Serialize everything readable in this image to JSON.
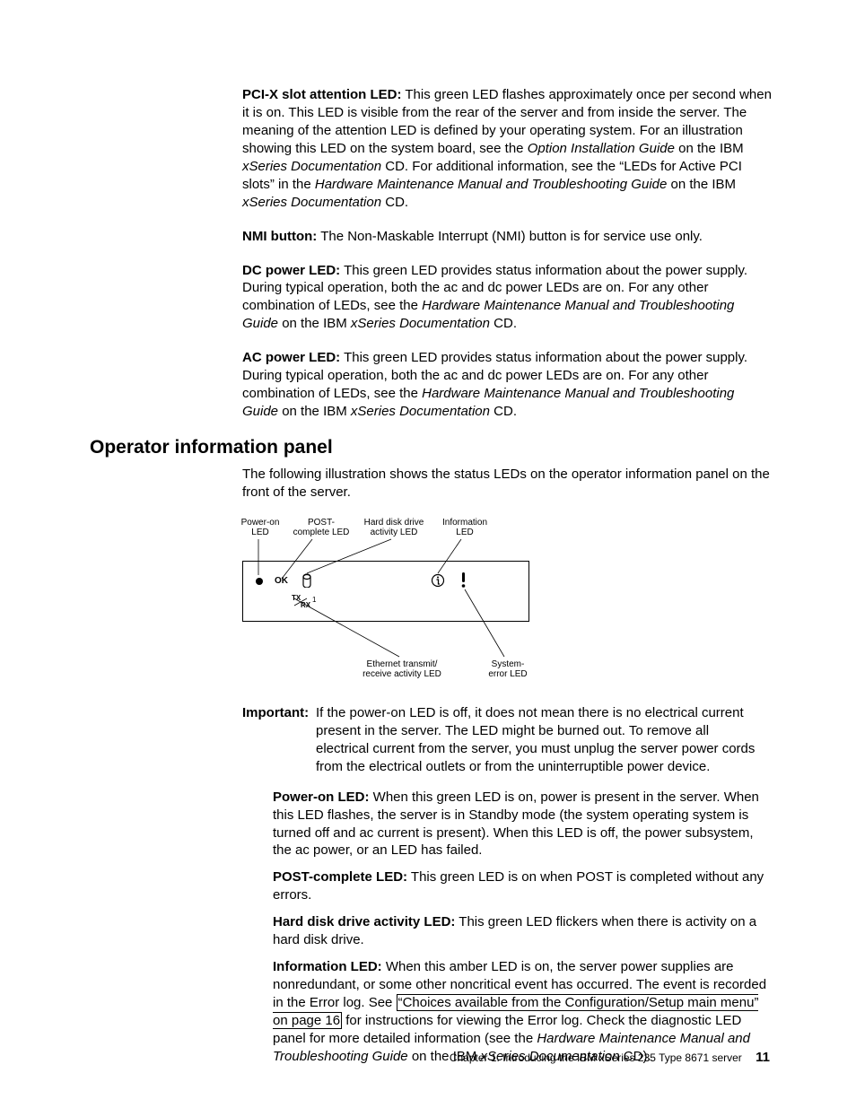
{
  "p1": {
    "lead": "PCI-X slot attention LED:",
    "t1": " This green LED flashes approximately once per second when it is on. This LED is visible from the rear of the server and from inside the server. The meaning of the attention LED is defined by your operating system. For an illustration showing this LED on the system board, see the ",
    "i1": "Option Installation Guide",
    "t2": " on the IBM ",
    "i2": "xSeries Documentation",
    "t3": " CD. For additional information, see the “LEDs for Active PCI slots” in the ",
    "i3": "Hardware Maintenance Manual and Troubleshooting Guide",
    "t4": " on the IBM ",
    "i4": "xSeries Documentation",
    "t5": " CD."
  },
  "p2": {
    "lead": "NMI button:",
    "t1": " The Non-Maskable Interrupt (NMI) button is for service use only."
  },
  "p3": {
    "lead": "DC power LED:",
    "t1": " This green LED provides status information about the power supply. During typical operation, both the ac and dc power LEDs are on. For any other combination of LEDs, see the ",
    "i1": "Hardware Maintenance Manual and Troubleshooting Guide",
    "t2": " on the IBM ",
    "i2": "xSeries Documentation",
    "t3": " CD."
  },
  "p4": {
    "lead": "AC power LED:",
    "t1": " This green LED provides status information about the power supply. During typical operation, both the ac and dc power LEDs are on. For any other combination of LEDs, see the ",
    "i1": "Hardware Maintenance Manual and Troubleshooting Guide",
    "t2": " on the IBM ",
    "i2": "xSeries Documentation",
    "t3": " CD."
  },
  "heading": "Operator information panel",
  "intro": "The following illustration shows the status LEDs on the operator information panel on the front of the server.",
  "diagram": {
    "power_on": "Power-on LED",
    "post_complete": "POST-complete LED",
    "hdd_activity": "Hard disk drive activity LED",
    "information": "Information LED",
    "ethernet": "Ethernet transmit/ receive activity LED",
    "system_error": "System-error LED",
    "ok": "OK",
    "tx": "TX",
    "rx": "RX",
    "one": "1"
  },
  "important": {
    "label": "Important:",
    "text": "If the power-on LED is off, it does not mean there is no electrical current present in the server. The LED might be burned out. To remove all electrical current from the server, you must unplug the server power cords from the electrical outlets or from the uninterruptible power device."
  },
  "d1": {
    "lead": "Power-on LED:",
    "t1": " When this green LED is on, power is present in the server. When this LED flashes, the server is in Standby mode (the system operating system is turned off and ac current is present). When this LED is off, the power subsystem, the ac power, or an LED has failed."
  },
  "d2": {
    "lead": "POST-complete LED:",
    "t1": " This green LED is on when POST is completed without any errors."
  },
  "d3": {
    "lead": "Hard disk drive activity LED:",
    "t1": " This green LED flickers when there is activity on a hard disk drive."
  },
  "d4": {
    "lead": "Information LED:",
    "t1": " When this amber LED is on, the server power supplies are nonredundant, or some other noncritical event has occurred. The event is recorded in the Error log. See ",
    "link": "“Choices available from the Configuration/Setup main menu” on page 16",
    "t2": " for instructions for viewing the Error log. Check the diagnostic LED panel for more detailed information (see the ",
    "i1": "Hardware Maintenance Manual and Troubleshooting Guide",
    "t3": " on the IBM ",
    "i2": "xSeries Documentation",
    "t4": " CD)."
  },
  "footer": {
    "chapter": "Chapter 1. Introducing the IBM xSeries 235 Type 8671 server",
    "page": "11"
  }
}
